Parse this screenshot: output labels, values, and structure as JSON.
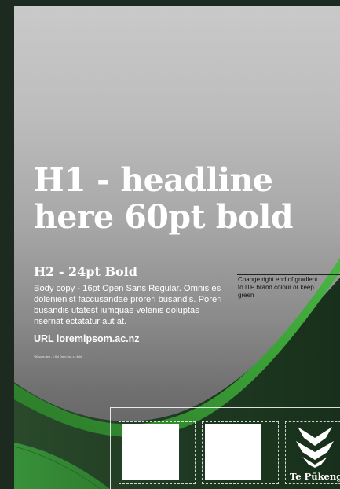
{
  "poster": {
    "headline": "H1 - headline here 60pt bold",
    "subheading": "H2 - 24pt Bold",
    "body_copy": "Body copy - 16pt Open Sans Regular. Omnis es dolenienist faccusandae proreri busandis. Poreri busandis utatest iumquae velenis doluptas nsernat ectatatur aut at.",
    "url": "URL loremipsom.ac.nz",
    "tiny_note": "*10 subs new - h 8pt Open Sa - s - light",
    "side_note": "Change right end of gradient to ITP brand colour or keep green",
    "brand_name": "Te Pūkenga",
    "colors": {
      "dark_green": "#1f3a22",
      "bright_green": "#3fa03a",
      "mid_green": "#2f6f2a"
    }
  }
}
